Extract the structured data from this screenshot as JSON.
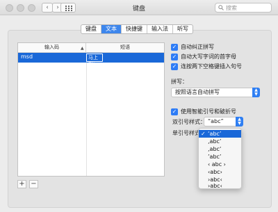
{
  "window": {
    "title": "键盘"
  },
  "toolbar": {
    "back": "‹",
    "forward": "›",
    "search_placeholder": "搜索"
  },
  "tabs": [
    {
      "label": "键盘",
      "active": false
    },
    {
      "label": "文本",
      "active": true
    },
    {
      "label": "快捷键",
      "active": false
    },
    {
      "label": "输入法",
      "active": false
    },
    {
      "label": "听写",
      "active": false
    }
  ],
  "table": {
    "col_replace": "输入码",
    "col_with": "短语",
    "rows": [
      {
        "replace": "msd",
        "with": "马上到！"
      }
    ]
  },
  "buttons": {
    "add": "+",
    "remove": "−"
  },
  "options": {
    "auto_correct": "自动纠正拼写",
    "auto_capitalize": "自动大写字词的首字母",
    "double_space_period": "连按两下空格键插入句号"
  },
  "spelling": {
    "label": "拼写：",
    "value": "按照语言自动拼写"
  },
  "smart_quotes": {
    "label": "使用智能引号和破折号",
    "double_label": "双引号样式：",
    "double_value": "“abc”",
    "single_label": "单引号样式：",
    "single_options": [
      "‘abc’",
      "‚abc’",
      "‚abc‘",
      "’abc’",
      "‹ abc ›",
      "‹abc›",
      "›abc‹",
      "›abc‹"
    ],
    "single_selected": 0
  },
  "colors": {
    "accent": "#2e7cf6",
    "selection": "#1a68d8"
  }
}
